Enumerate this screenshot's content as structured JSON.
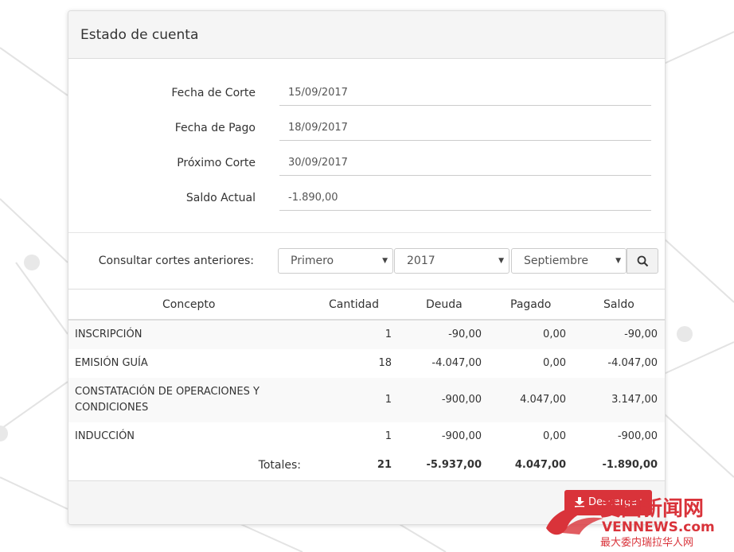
{
  "panel": {
    "title": "Estado de cuenta"
  },
  "fields": [
    {
      "label": "Fecha de Corte",
      "value": "15/09/2017"
    },
    {
      "label": "Fecha de Pago",
      "value": "18/09/2017"
    },
    {
      "label": "Próximo Corte",
      "value": "30/09/2017"
    },
    {
      "label": "Saldo Actual",
      "value": "-1.890,00"
    }
  ],
  "consult": {
    "label": "Consultar cortes anteriores:",
    "period": "Primero",
    "year": "2017",
    "month": "Septiembre"
  },
  "table": {
    "headers": [
      "Concepto",
      "Cantidad",
      "Deuda",
      "Pagado",
      "Saldo"
    ],
    "rows": [
      {
        "concepto": "INSCRIPCIÓN",
        "concepto2": "",
        "cantidad": "1",
        "deuda": "-90,00",
        "pagado": "0,00",
        "saldo": "-90,00"
      },
      {
        "concepto": "EMISIÓN GUÍA",
        "concepto2": "",
        "cantidad": "18",
        "deuda": "-4.047,00",
        "pagado": "0,00",
        "saldo": "-4.047,00"
      },
      {
        "concepto": "CONSTATACIÓN DE OPERACIONES Y",
        "concepto2": "CONDICIONES",
        "cantidad": "1",
        "deuda": "-900,00",
        "pagado": "4.047,00",
        "saldo": "3.147,00"
      },
      {
        "concepto": "INDUCCIÓN",
        "concepto2": "",
        "cantidad": "1",
        "deuda": "-900,00",
        "pagado": "0,00",
        "saldo": "-900,00"
      }
    ],
    "totals": {
      "label": "Totales:",
      "cantidad": "21",
      "deuda": "-5.937,00",
      "pagado": "4.047,00",
      "saldo": "-1.890,00"
    }
  },
  "footer": {
    "download_label": "Descargar"
  },
  "watermark": {
    "line1": "委国新闻网",
    "line2": "VENNEWS.com",
    "line3": "最大委内瑞拉华人网"
  },
  "colors": {
    "download_button": "#d9333a",
    "watermark_red": "#d9333a"
  }
}
